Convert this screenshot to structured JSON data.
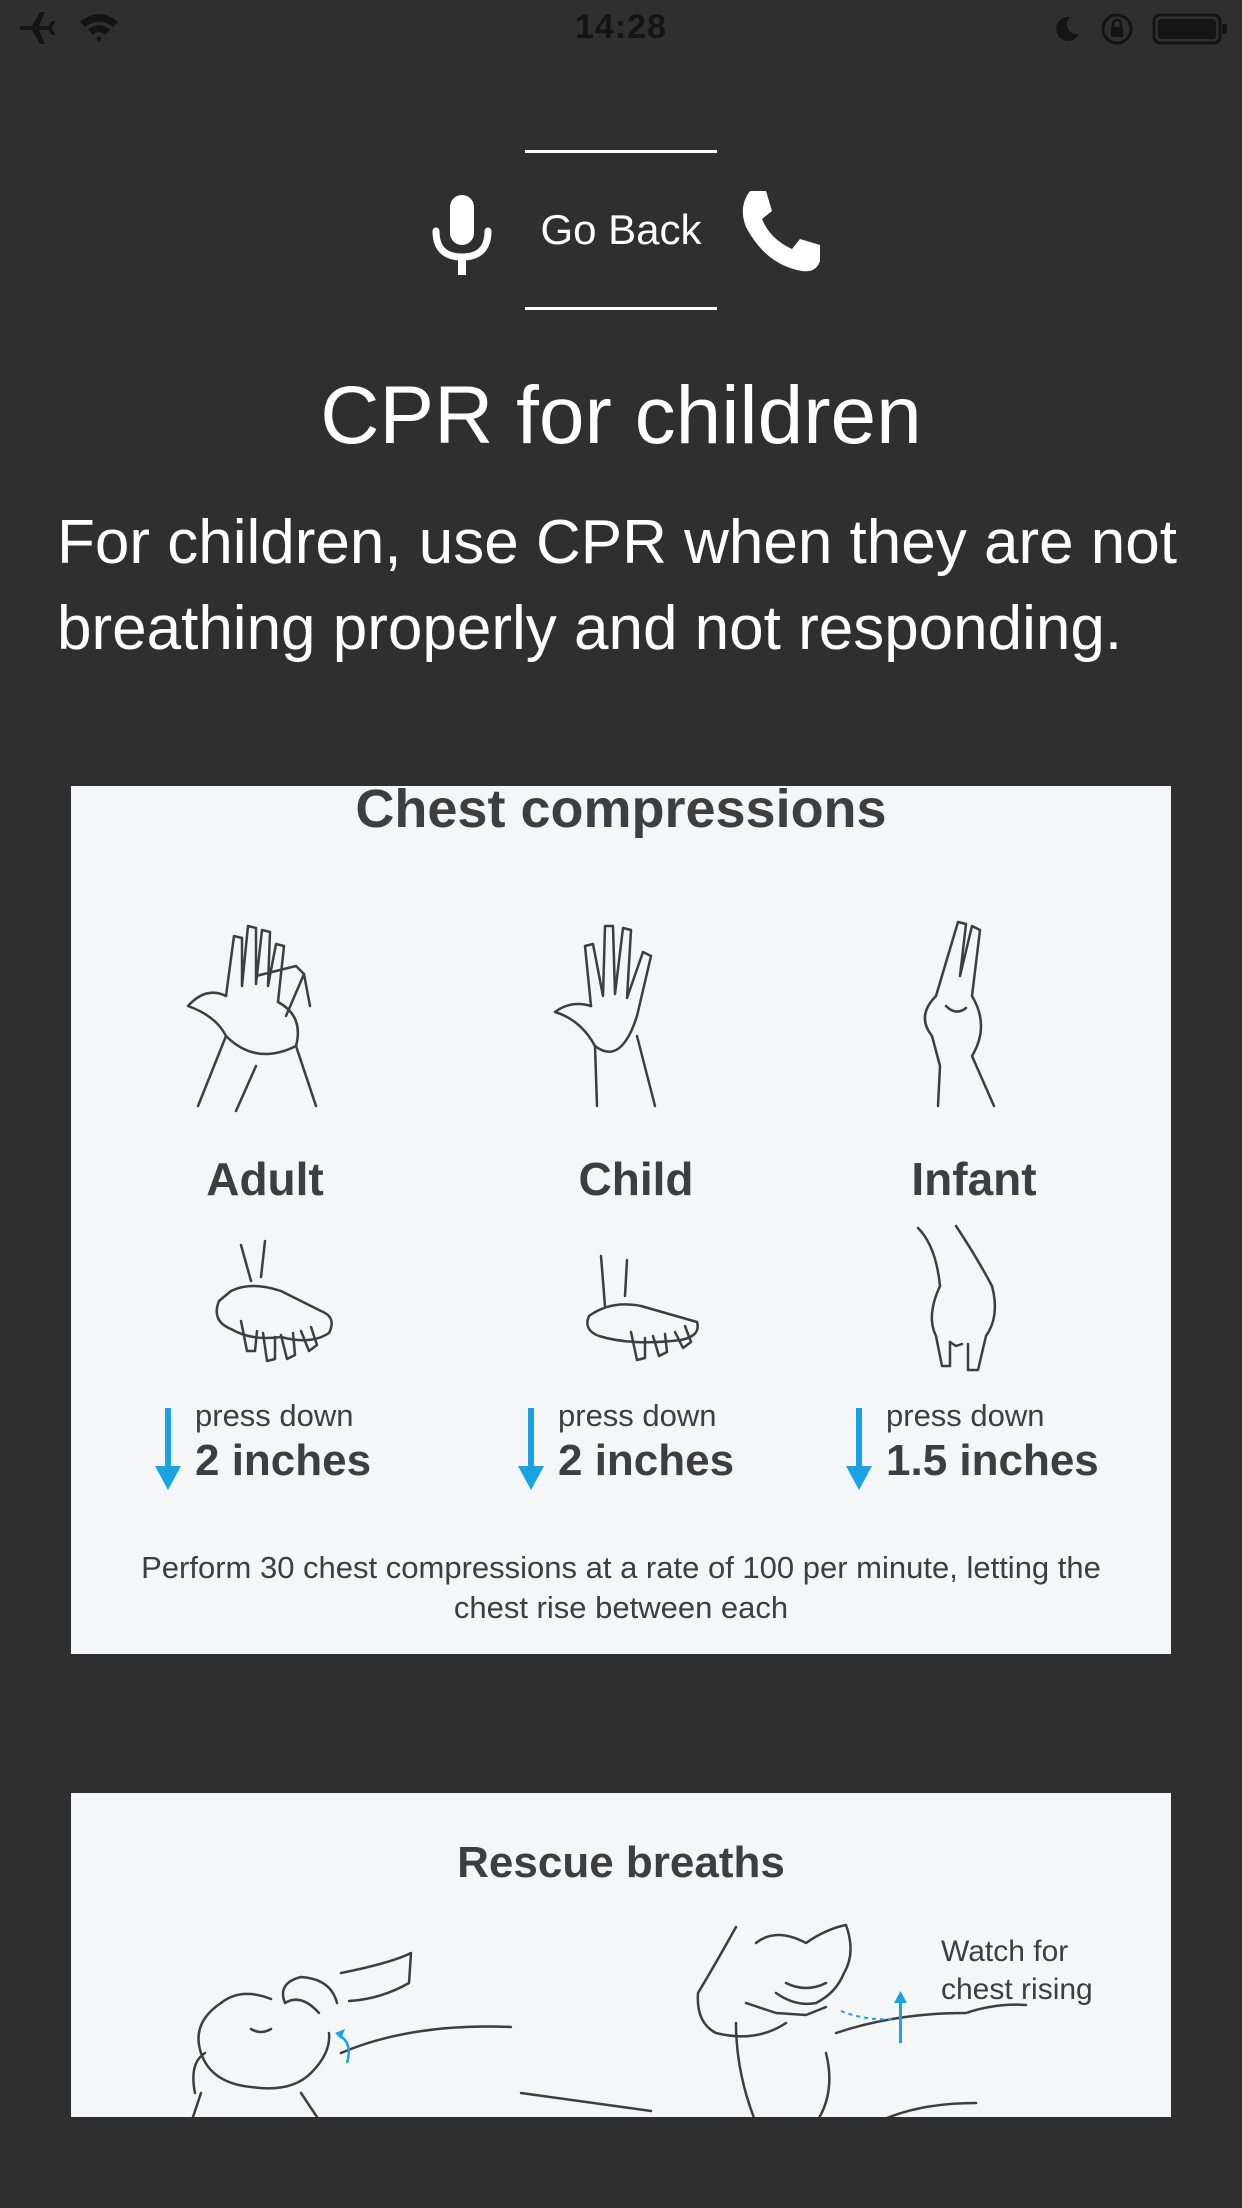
{
  "status_bar": {
    "time": "14:28",
    "icons": [
      "airplane-icon",
      "wifi-icon",
      "moon-icon",
      "orientation-lock-icon",
      "battery-icon"
    ]
  },
  "nav": {
    "back_label": "Go Back",
    "icons": [
      "microphone-icon",
      "phone-icon"
    ]
  },
  "page": {
    "title": "CPR for children",
    "intro": "For children, use CPR when they are not breathing properly and not responding."
  },
  "compressions_image": {
    "heading": "Chest compressions",
    "columns": [
      {
        "label": "Adult",
        "press_text": "press down",
        "amount": "2 inches"
      },
      {
        "label": "Child",
        "press_text": "press down",
        "amount": "2 inches"
      },
      {
        "label": "Infant",
        "press_text": "press down",
        "amount": "1.5 inches"
      }
    ],
    "footer": "Perform 30 chest compressions at a rate of 100 per minute, letting the chest rise between each"
  },
  "breaths_image": {
    "heading": "Rescue breaths",
    "watch_label_line1": "Watch for",
    "watch_label_line2": "chest rising"
  },
  "colors": {
    "background": "#2f2f2f",
    "text": "#ffffff",
    "card": "#f5f6f8",
    "card_text": "#3e3e3e",
    "accent_arrow": "#1aa3e0"
  }
}
